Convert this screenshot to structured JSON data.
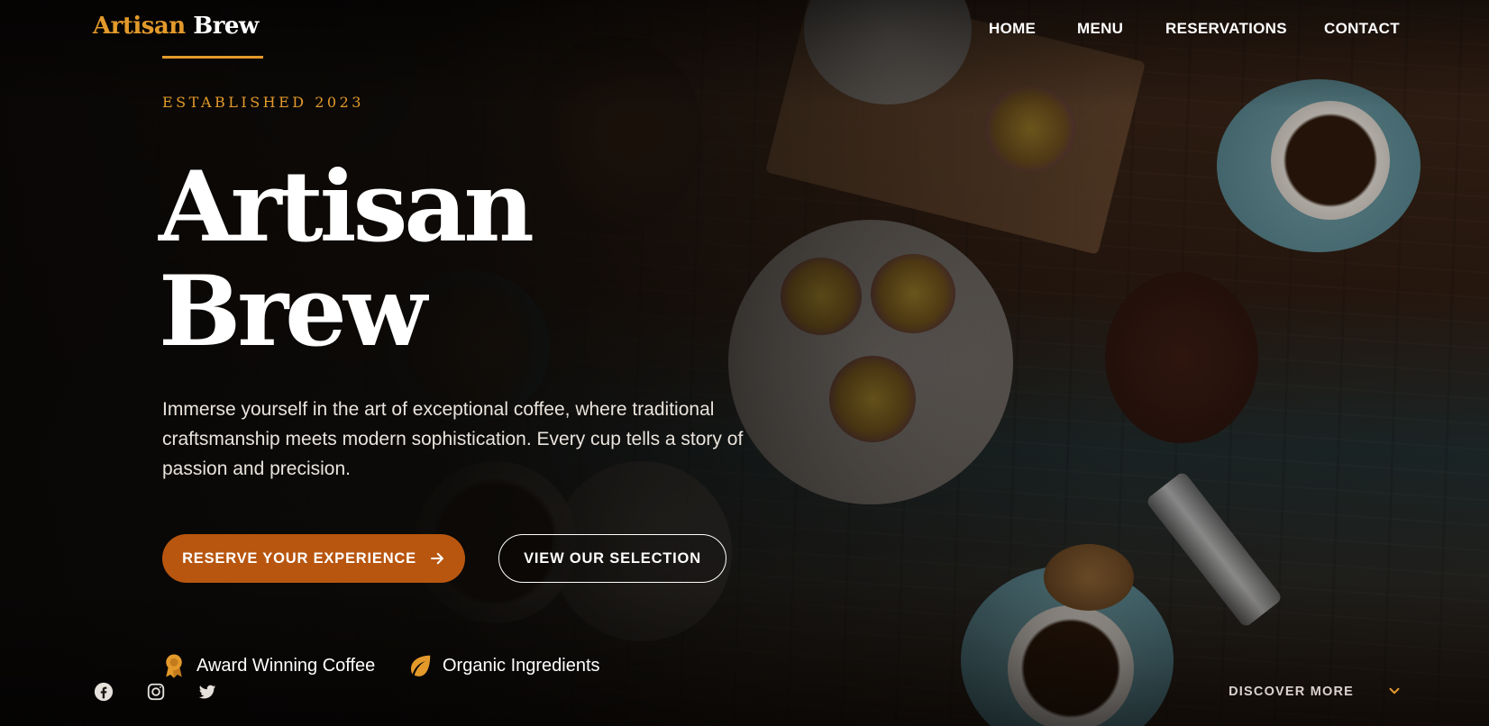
{
  "brand": {
    "part1": "Artisan",
    "part2": "Brew"
  },
  "nav": {
    "home": "HOME",
    "menu": "MENU",
    "reservations": "RESERVATIONS",
    "contact": "CONTACT"
  },
  "hero": {
    "eyebrow": "ESTABLISHED 2023",
    "title_line1": "Artisan",
    "title_line2": "Brew",
    "description": "Immerse yourself in the art of exceptional coffee, where traditional craftsmanship meets modern sophistication. Every cup tells a story of passion and precision.",
    "primary_cta": "RESERVE YOUR EXPERIENCE",
    "secondary_cta": "VIEW OUR SELECTION"
  },
  "features": [
    {
      "icon": "award-ribbon-icon",
      "label": "Award Winning Coffee"
    },
    {
      "icon": "leaf-icon",
      "label": "Organic Ingredients"
    }
  ],
  "social": [
    "facebook-icon",
    "instagram-icon",
    "twitter-icon"
  ],
  "discover": {
    "label": "DISCOVER MORE",
    "icon": "chevron-down-icon"
  },
  "colors": {
    "accent": "#e39a2b",
    "primary_button": "#b8560f",
    "background": "#0d0a08"
  }
}
